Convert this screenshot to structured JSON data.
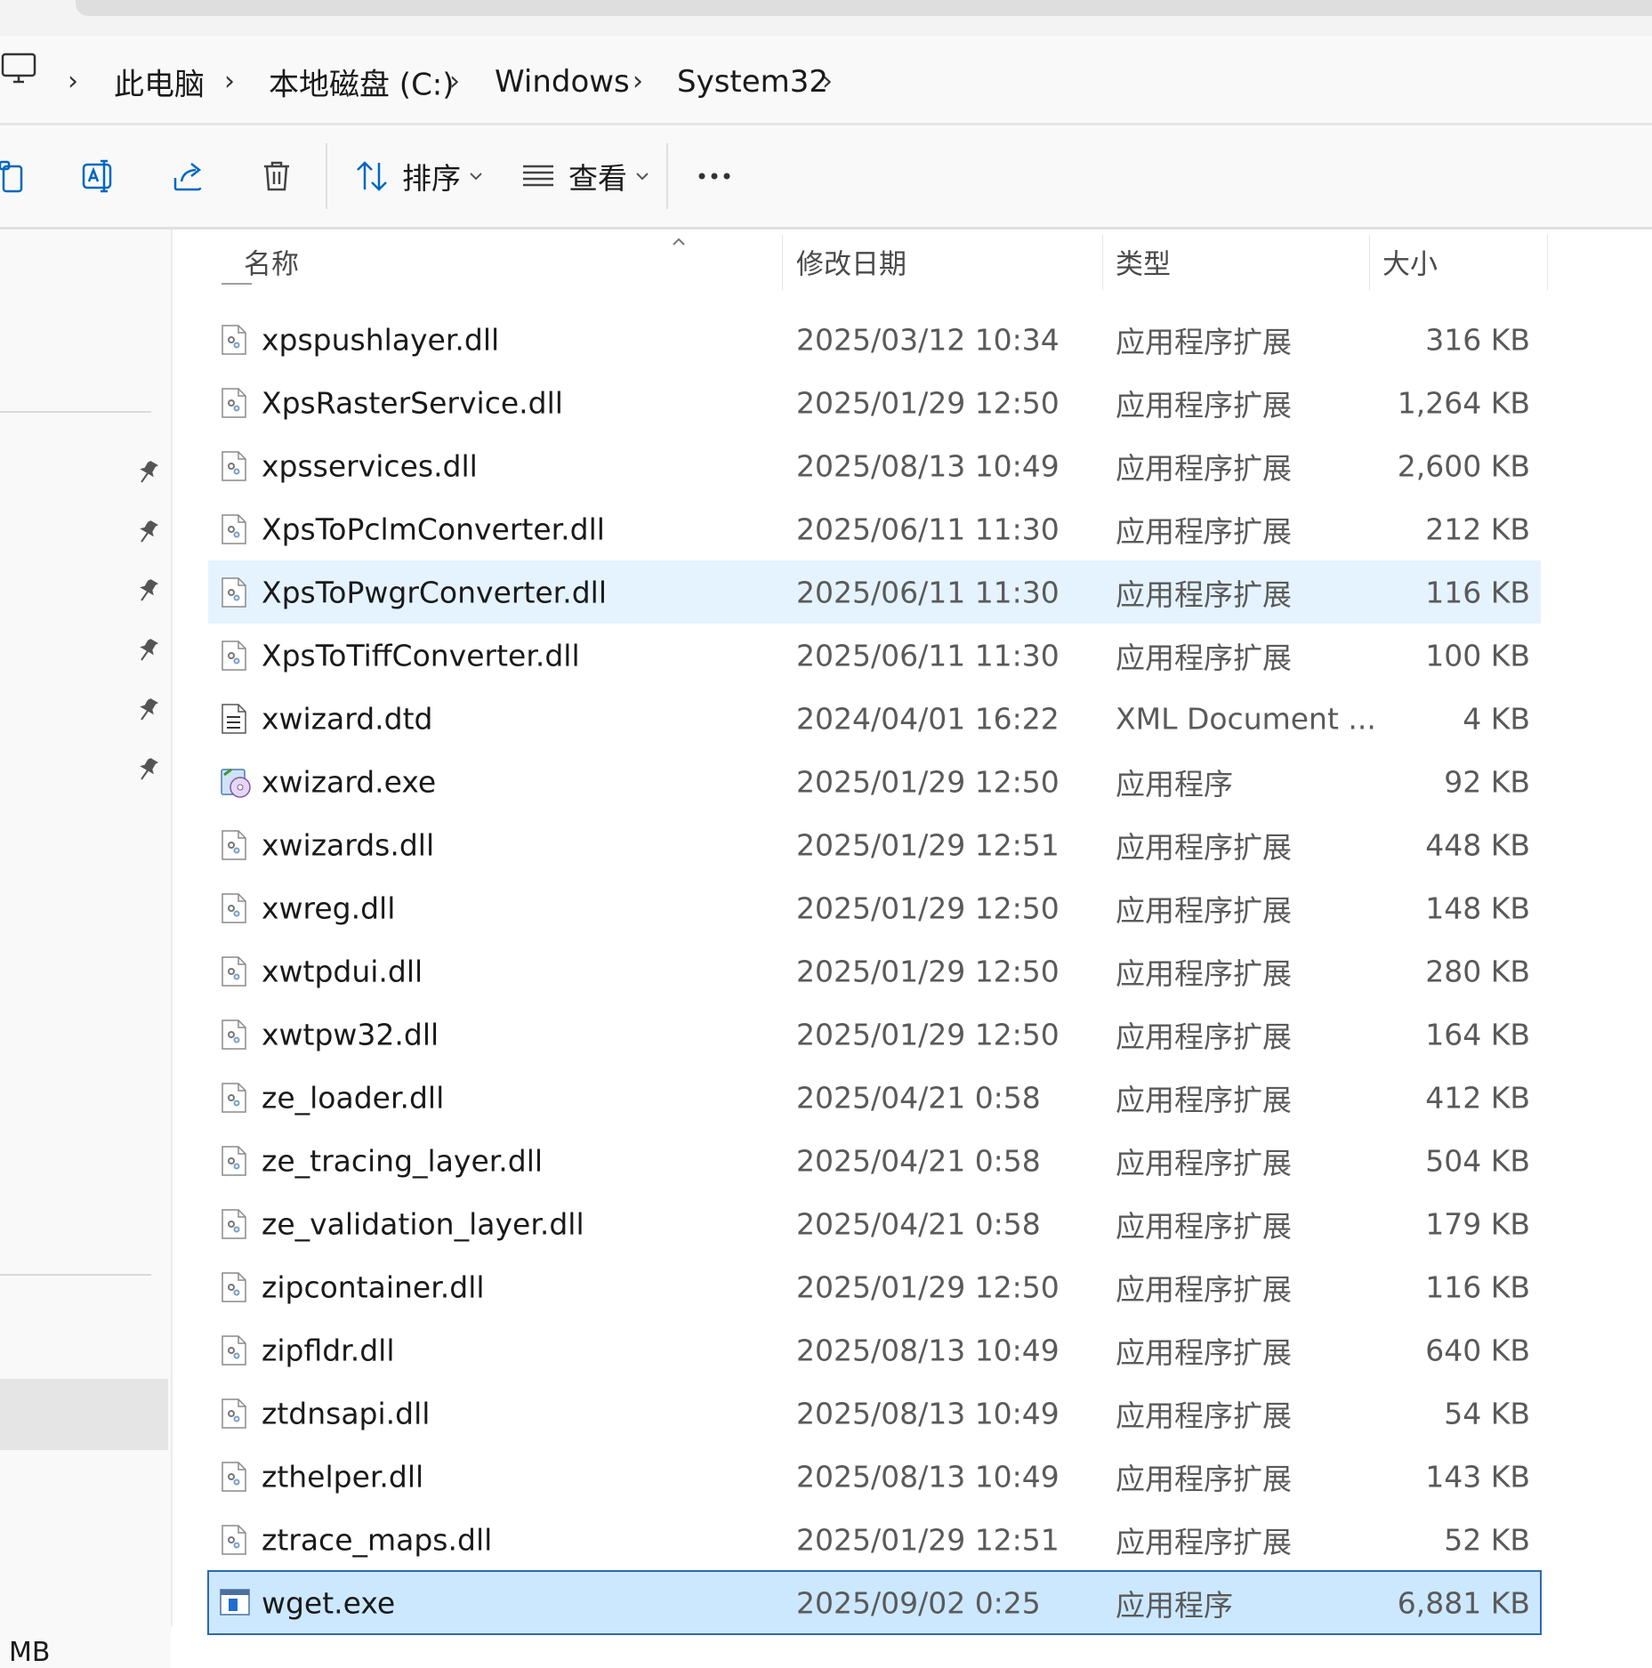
{
  "breadcrumb": {
    "items": [
      "此电脑",
      "本地磁盘 (C:)",
      "Windows",
      "System32"
    ]
  },
  "toolbar": {
    "sort_label": "排序",
    "view_label": "查看"
  },
  "columns": {
    "name": "名称",
    "modified": "修改日期",
    "type": "类型",
    "size": "大小"
  },
  "files": [
    {
      "name": "xpspushlayer.dll",
      "modified": "2025/03/12 10:34",
      "type": "应用程序扩展",
      "size": "316 KB",
      "icon": "dll-file-icon"
    },
    {
      "name": "XpsRasterService.dll",
      "modified": "2025/01/29 12:50",
      "type": "应用程序扩展",
      "size": "1,264 KB",
      "icon": "dll-file-icon"
    },
    {
      "name": "xpsservices.dll",
      "modified": "2025/08/13 10:49",
      "type": "应用程序扩展",
      "size": "2,600 KB",
      "icon": "dll-file-icon"
    },
    {
      "name": "XpsToPclmConverter.dll",
      "modified": "2025/06/11 11:30",
      "type": "应用程序扩展",
      "size": "212 KB",
      "icon": "dll-file-icon"
    },
    {
      "name": "XpsToPwgrConverter.dll",
      "modified": "2025/06/11 11:30",
      "type": "应用程序扩展",
      "size": "116 KB",
      "icon": "dll-file-icon"
    },
    {
      "name": "XpsToTiffConverter.dll",
      "modified": "2025/06/11 11:30",
      "type": "应用程序扩展",
      "size": "100 KB",
      "icon": "dll-file-icon"
    },
    {
      "name": "xwizard.dtd",
      "modified": "2024/04/01 16:22",
      "type": "XML Document ...",
      "size": "4 KB",
      "icon": "dtd-file-icon"
    },
    {
      "name": "xwizard.exe",
      "modified": "2025/01/29 12:50",
      "type": "应用程序",
      "size": "92 KB",
      "icon": "wizard-exe-icon"
    },
    {
      "name": "xwizards.dll",
      "modified": "2025/01/29 12:51",
      "type": "应用程序扩展",
      "size": "448 KB",
      "icon": "dll-file-icon"
    },
    {
      "name": "xwreg.dll",
      "modified": "2025/01/29 12:50",
      "type": "应用程序扩展",
      "size": "148 KB",
      "icon": "dll-file-icon"
    },
    {
      "name": "xwtpdui.dll",
      "modified": "2025/01/29 12:50",
      "type": "应用程序扩展",
      "size": "280 KB",
      "icon": "dll-file-icon"
    },
    {
      "name": "xwtpw32.dll",
      "modified": "2025/01/29 12:50",
      "type": "应用程序扩展",
      "size": "164 KB",
      "icon": "dll-file-icon"
    },
    {
      "name": "ze_loader.dll",
      "modified": "2025/04/21 0:58",
      "type": "应用程序扩展",
      "size": "412 KB",
      "icon": "dll-file-icon"
    },
    {
      "name": "ze_tracing_layer.dll",
      "modified": "2025/04/21 0:58",
      "type": "应用程序扩展",
      "size": "504 KB",
      "icon": "dll-file-icon"
    },
    {
      "name": "ze_validation_layer.dll",
      "modified": "2025/04/21 0:58",
      "type": "应用程序扩展",
      "size": "179 KB",
      "icon": "dll-file-icon"
    },
    {
      "name": "zipcontainer.dll",
      "modified": "2025/01/29 12:50",
      "type": "应用程序扩展",
      "size": "116 KB",
      "icon": "dll-file-icon"
    },
    {
      "name": "zipfldr.dll",
      "modified": "2025/08/13 10:49",
      "type": "应用程序扩展",
      "size": "640 KB",
      "icon": "dll-file-icon"
    },
    {
      "name": "ztdnsapi.dll",
      "modified": "2025/08/13 10:49",
      "type": "应用程序扩展",
      "size": "54 KB",
      "icon": "dll-file-icon"
    },
    {
      "name": "zthelper.dll",
      "modified": "2025/08/13 10:49",
      "type": "应用程序扩展",
      "size": "143 KB",
      "icon": "dll-file-icon"
    },
    {
      "name": "ztrace_maps.dll",
      "modified": "2025/01/29 12:51",
      "type": "应用程序扩展",
      "size": "52 KB",
      "icon": "dll-file-icon"
    },
    {
      "name": "wget.exe",
      "modified": "2025/09/02 0:25",
      "type": "应用程序",
      "size": "6,881 KB",
      "icon": "app-exe-icon"
    }
  ],
  "hovered_row": 4,
  "selected_row": 20,
  "status": {
    "size_unit": "MB"
  },
  "colors": {
    "hover_row": "#e5f3ff",
    "selected_row": "#cce8ff",
    "selected_border": "#2d6aa8",
    "accent": "#0067c0"
  }
}
